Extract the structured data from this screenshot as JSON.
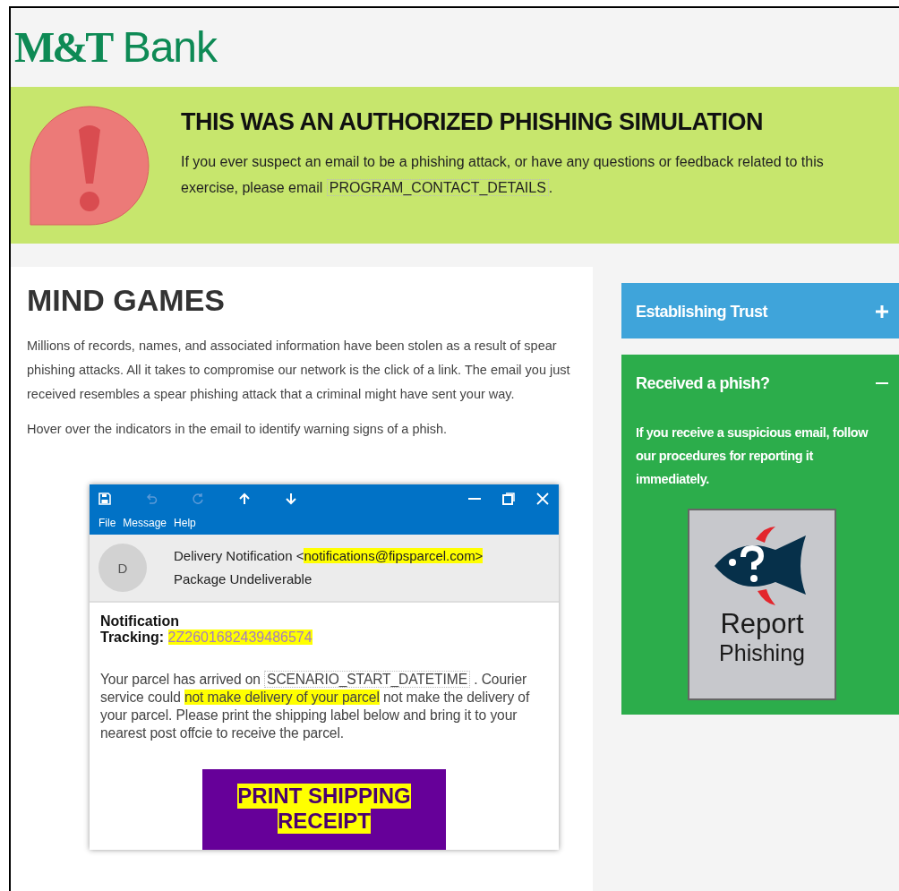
{
  "logo": {
    "brand": "M&T",
    "suffix": "Bank"
  },
  "banner": {
    "title": "THIS WAS AN AUTHORIZED PHISHING SIMULATION",
    "segments": [
      {
        "kind": "plain",
        "text": "If you ever suspect an email to be a phishing attack, or have any questions or feedback related to this exercise, please email "
      },
      {
        "kind": "token",
        "text": "PROGRAM_CONTACT_DETAILS"
      },
      {
        "kind": "plain",
        "text": "."
      }
    ]
  },
  "article": {
    "title": "MIND GAMES",
    "paragraphs": [
      "Millions of records, names, and associated information have been stolen as a result of spear phishing attacks. All it takes to compromise our network is the click of a link. The email you just received resembles a spear phishing attack that a criminal might have sent your way.",
      "Hover over the indicators in the email to identify warning signs of a phish."
    ]
  },
  "email": {
    "menu": [
      "File",
      "Message",
      "Help"
    ],
    "avatar": "D",
    "sender_name": "Delivery Notification <",
    "sender_address": "notifications@fipsparcel.com>",
    "subject": "Package Undeliverable",
    "heading": "Notification",
    "tracking_label": "Tracking:",
    "tracking_number": "2Z2601682439486574",
    "body": [
      {
        "kind": "plain",
        "text": "Your parcel has arrived on "
      },
      {
        "kind": "token",
        "text": "SCENARIO_START_DATETIME"
      },
      {
        "kind": "plain",
        "text": " . Courier service could "
      },
      {
        "kind": "highlight",
        "text": "not make delivery of your parcel"
      },
      {
        "kind": "plain",
        "text": " not make the delivery of your parcel. Please print the shipping label below and bring it to your nearest post offcie to receive the parcel."
      }
    ],
    "button": [
      "PRINT  SHIPPING",
      "RECEIPT"
    ]
  },
  "accordion": [
    {
      "title": "Establishing Trust",
      "expanded": false,
      "color": "#3fa4da"
    },
    {
      "title": "Received a phish?",
      "expanded": true,
      "color": "#2cad4b",
      "body": "If you receive a suspicious email, follow our procedures for reporting it immediately.",
      "report_button": [
        "Report",
        "Phishing"
      ]
    }
  ]
}
